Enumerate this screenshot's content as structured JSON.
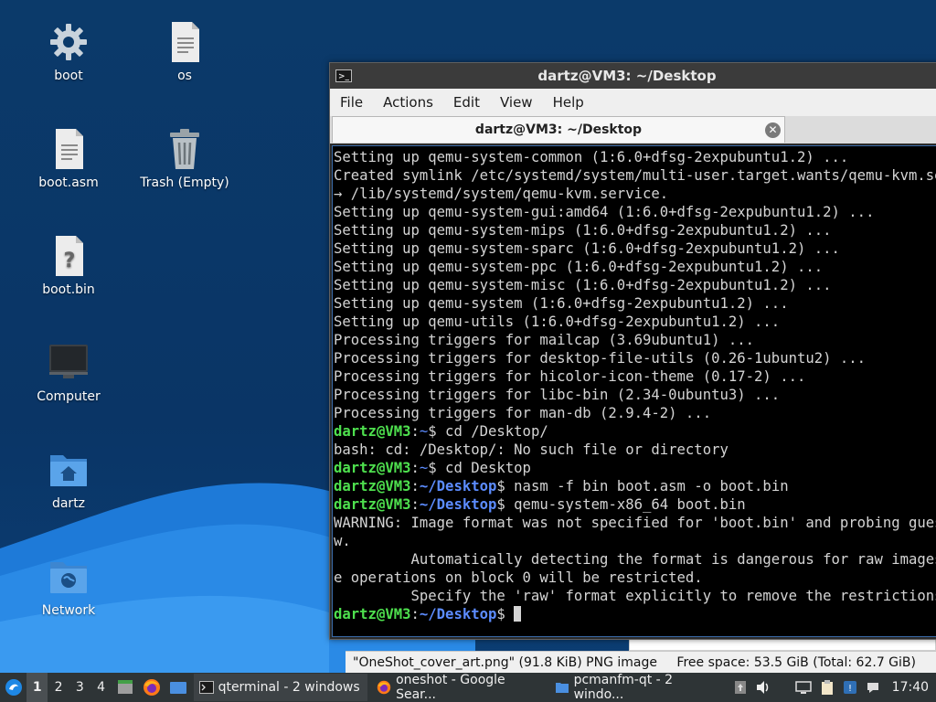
{
  "desktop": {
    "icons": [
      {
        "label": "boot",
        "icon": "gear-icon"
      },
      {
        "label": "os",
        "icon": "text-file-icon"
      },
      {
        "label": "boot.asm",
        "icon": "text-file-icon"
      },
      {
        "label": "Trash (Empty)",
        "icon": "trash-icon"
      },
      {
        "label": "boot.bin",
        "icon": "unknown-file-icon"
      },
      {
        "label": "Computer",
        "icon": "computer-icon"
      },
      {
        "label": "dartz",
        "icon": "home-folder-icon"
      },
      {
        "label": "Network",
        "icon": "network-folder-icon"
      }
    ]
  },
  "terminal": {
    "title": "dartz@VM3: ~/Desktop",
    "menu": [
      "File",
      "Actions",
      "Edit",
      "View",
      "Help"
    ],
    "tab_title": "dartz@VM3: ~/Desktop",
    "lines": [
      {
        "text": "Setting up qemu-system-common (1:6.0+dfsg-2expubuntu1.2) ..."
      },
      {
        "text": "Created symlink /etc/systemd/system/multi-user.target.wants/qemu-kvm.service"
      },
      {
        "text": "→ /lib/systemd/system/qemu-kvm.service."
      },
      {
        "text": "Setting up qemu-system-gui:amd64 (1:6.0+dfsg-2expubuntu1.2) ..."
      },
      {
        "text": "Setting up qemu-system-mips (1:6.0+dfsg-2expubuntu1.2) ..."
      },
      {
        "text": "Setting up qemu-system-sparc (1:6.0+dfsg-2expubuntu1.2) ..."
      },
      {
        "text": "Setting up qemu-system-ppc (1:6.0+dfsg-2expubuntu1.2) ..."
      },
      {
        "text": "Setting up qemu-system-misc (1:6.0+dfsg-2expubuntu1.2) ..."
      },
      {
        "text": "Setting up qemu-system (1:6.0+dfsg-2expubuntu1.2) ..."
      },
      {
        "text": "Setting up qemu-utils (1:6.0+dfsg-2expubuntu1.2) ..."
      },
      {
        "text": "Processing triggers for mailcap (3.69ubuntu1) ..."
      },
      {
        "text": "Processing triggers for desktop-file-utils (0.26-1ubuntu2) ..."
      },
      {
        "text": "Processing triggers for hicolor-icon-theme (0.17-2) ..."
      },
      {
        "text": "Processing triggers for libc-bin (2.34-0ubuntu3) ..."
      },
      {
        "text": "Processing triggers for man-db (2.9.4-2) ..."
      },
      {
        "user": "dartz@VM3",
        "path": "~",
        "cmd": "$ cd /Desktop/"
      },
      {
        "text": "bash: cd: /Desktop/: No such file or directory"
      },
      {
        "user": "dartz@VM3",
        "path": "~",
        "cmd": "$ cd Desktop"
      },
      {
        "user": "dartz@VM3",
        "path": "~/Desktop",
        "cmd": "$ nasm -f bin boot.asm -o boot.bin"
      },
      {
        "user": "dartz@VM3",
        "path": "~/Desktop",
        "cmd": "$ qemu-system-x86_64 boot.bin"
      },
      {
        "text": "WARNING: Image format was not specified for 'boot.bin' and probing guessed ra"
      },
      {
        "text": "w."
      },
      {
        "text": "         Automatically detecting the format is dangerous for raw images, writ"
      },
      {
        "text": "e operations on block 0 will be restricted."
      },
      {
        "text": "         Specify the 'raw' format explicitly to remove the restrictions."
      },
      {
        "user": "dartz@VM3",
        "path": "~/Desktop",
        "cmd": "$ ",
        "cursor": true
      }
    ]
  },
  "file_manager": {
    "status_left": "\"OneShot_cover_art.png\" (91.8 KiB) PNG image",
    "status_right": "Free space: 53.5 GiB (Total: 62.7 GiB)"
  },
  "taskbar": {
    "workspaces": [
      "1",
      "2",
      "3",
      "4"
    ],
    "active_workspace": "1",
    "tasks": [
      {
        "label": "qterminal - 2 windows",
        "icon": "terminal-icon"
      },
      {
        "label": "oneshot - Google Sear...",
        "icon": "firefox-icon"
      },
      {
        "label": "pcmanfm-qt - 2 windo...",
        "icon": "folder-icon"
      }
    ],
    "clock": "17:40"
  },
  "colors": {
    "prompt_user": "#4ee04e",
    "prompt_path": "#5c8cff",
    "desktop_bg": "#0b3a6a",
    "wave": "#1a6fd0"
  }
}
